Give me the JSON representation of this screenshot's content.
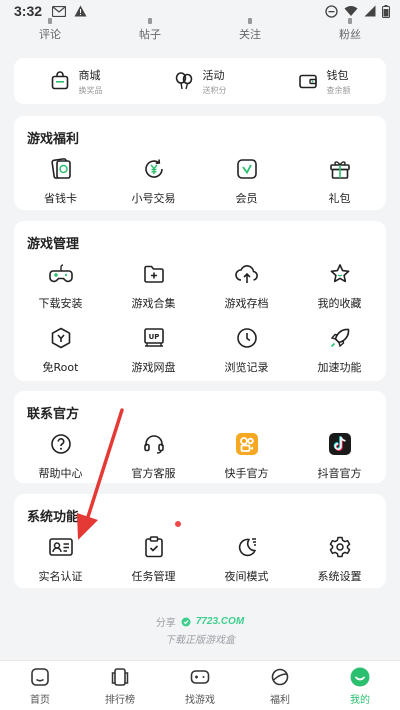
{
  "status_bar": {
    "time": "3:32",
    "left_icons": [
      "gmail-icon",
      "alert-icon"
    ],
    "right_icons": [
      "dnd-icon",
      "wifi-icon",
      "signal-icon",
      "battery-icon"
    ]
  },
  "stats": [
    "评论",
    "帖子",
    "关注",
    "粉丝"
  ],
  "quick_links": [
    {
      "name": "商城",
      "sub": "换奖品",
      "icon": "shop-bag-icon"
    },
    {
      "name": "活动",
      "sub": "送积分",
      "icon": "balloon-icon"
    },
    {
      "name": "钱包",
      "sub": "查余额",
      "icon": "wallet-icon"
    }
  ],
  "welfare": {
    "title": "游戏福利",
    "items": [
      {
        "label": "省钱卡",
        "icon": "money-card-icon"
      },
      {
        "label": "小号交易",
        "icon": "yen-exchange-icon"
      },
      {
        "label": "会员",
        "icon": "vip-badge-icon"
      },
      {
        "label": "礼包",
        "icon": "gift-icon"
      }
    ]
  },
  "manage": {
    "title": "游戏管理",
    "items": [
      {
        "label": "下载安装",
        "icon": "gamepad-icon"
      },
      {
        "label": "游戏合集",
        "icon": "folder-plus-icon"
      },
      {
        "label": "游戏存档",
        "icon": "cloud-upload-icon"
      },
      {
        "label": "我的收藏",
        "icon": "star-icon"
      },
      {
        "label": "免Root",
        "icon": "shield-y-icon"
      },
      {
        "label": "游戏网盘",
        "icon": "cloud-drive-up-icon"
      },
      {
        "label": "浏览记录",
        "icon": "clock-icon"
      },
      {
        "label": "加速功能",
        "icon": "rocket-icon"
      }
    ]
  },
  "official": {
    "title": "联系官方",
    "items": [
      {
        "label": "帮助中心",
        "icon": "help-circle-icon"
      },
      {
        "label": "官方客服",
        "icon": "headset-icon"
      },
      {
        "label": "快手官方",
        "icon": "kuaishou-icon"
      },
      {
        "label": "抖音官方",
        "icon": "douyin-icon"
      }
    ]
  },
  "system": {
    "title": "系统功能",
    "items": [
      {
        "label": "实名认证",
        "icon": "id-card-icon"
      },
      {
        "label": "任务管理",
        "icon": "task-clipboard-icon"
      },
      {
        "label": "夜间模式",
        "icon": "moon-icon"
      },
      {
        "label": "系统设置",
        "icon": "settings-gear-icon"
      }
    ]
  },
  "footer": {
    "share": "分享",
    "brand": "7723.COM",
    "slogan": "下载正版游戏盒"
  },
  "bottom_nav": [
    {
      "label": "首页",
      "icon": "home-icon",
      "active": false
    },
    {
      "label": "排行榜",
      "icon": "ranking-icon",
      "active": false
    },
    {
      "label": "找游戏",
      "icon": "controller-icon",
      "active": false
    },
    {
      "label": "福利",
      "icon": "planet-icon",
      "active": false
    },
    {
      "label": "我的",
      "icon": "smile-profile-icon",
      "active": true
    }
  ],
  "colors": {
    "accent": "#2bbf6f",
    "red_dot": "#f04848",
    "arrow": "#e53935",
    "kuaishou": "#f7a823",
    "douyin": "#1a1a1a"
  }
}
